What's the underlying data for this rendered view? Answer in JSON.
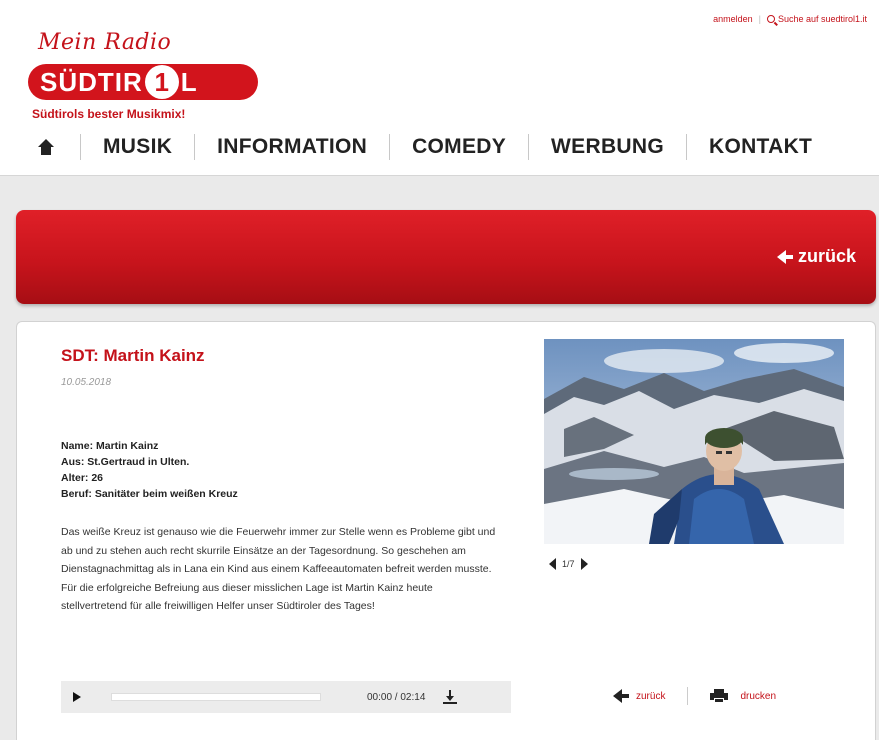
{
  "colors": {
    "brand_red": "#c4121a",
    "banner_red": "#d2141c"
  },
  "top_links": {
    "login": "anmelden",
    "search": "Suche auf suedtirol1.it"
  },
  "logo": {
    "script": "Mein Radio",
    "word_left": "SÜDTIR",
    "word_one": "1",
    "word_right": "L",
    "tagline": "Südtirols bester Musikmix!"
  },
  "nav": {
    "home_icon": "home-icon",
    "items": [
      "MUSIK",
      "INFORMATION",
      "COMEDY",
      "WERBUNG",
      "KONTAKT"
    ]
  },
  "banner": {
    "back_label": "zurück"
  },
  "article": {
    "title": "SDT: Martin Kainz",
    "date": "10.05.2018",
    "facts": [
      "Name: Martin Kainz",
      "Aus: St.Gertraud in Ulten.",
      "Alter: 26",
      "Beruf: Sanitäter beim weißen Kreuz"
    ],
    "body": "Das weiße Kreuz ist genauso wie die Feuerwehr immer zur Stelle wenn es Probleme gibt und ab und zu stehen auch recht skurrile Einsätze an der Tagesordnung. So geschehen am Dienstagnachmittag als in Lana ein Kind aus einem Kaffeeautomaten befreit werden musste. Für die erfolgreiche Befreiung aus dieser misslichen Lage ist Martin Kainz heute stellvertretend für alle freiwilligen Helfer unser Südtiroler des Tages!"
  },
  "gallery": {
    "pager": "1/7"
  },
  "player": {
    "time": "00:00 / 02:14",
    "progress": 0
  },
  "actions": {
    "back": "zurück",
    "print": "drucken"
  }
}
